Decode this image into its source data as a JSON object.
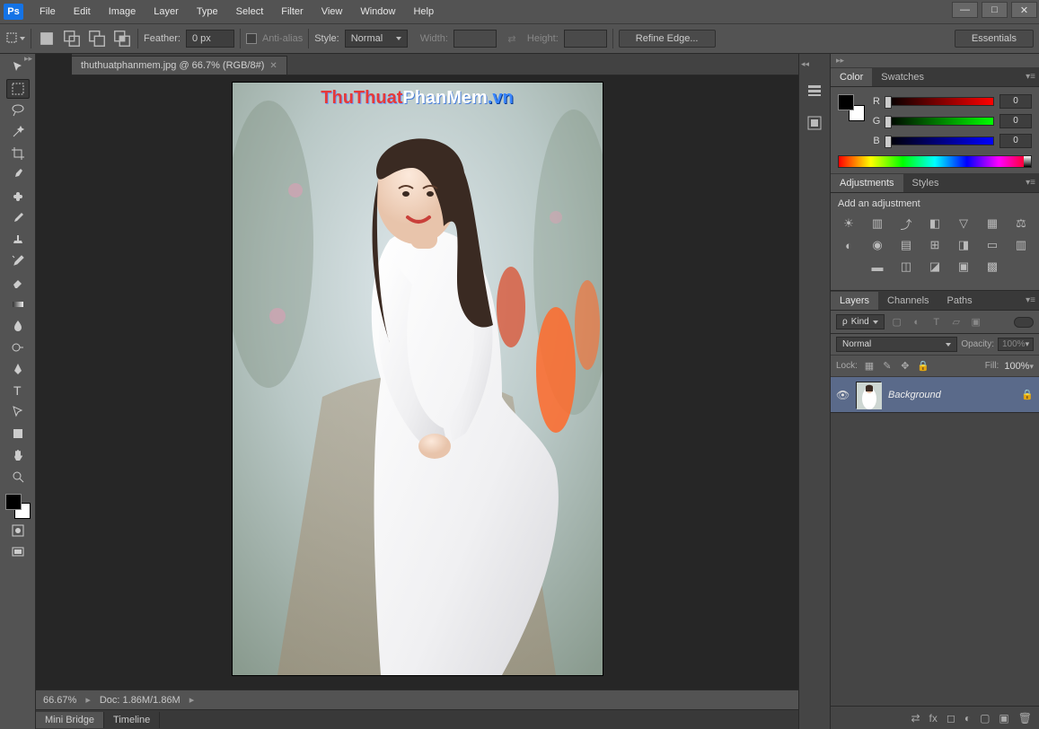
{
  "app": {
    "logo": "Ps"
  },
  "menu": [
    "File",
    "Edit",
    "Image",
    "Layer",
    "Type",
    "Select",
    "Filter",
    "View",
    "Window",
    "Help"
  ],
  "window_controls": {
    "min": "—",
    "max": "□",
    "close": "✕"
  },
  "options": {
    "feather_label": "Feather:",
    "feather_value": "0 px",
    "antialias": "Anti-alias",
    "style_label": "Style:",
    "style_value": "Normal",
    "width_label": "Width:",
    "height_label": "Height:",
    "refine": "Refine Edge...",
    "workspace": "Essentials"
  },
  "document": {
    "tab_title": "thuthuatphanmem.jpg @ 66.7% (RGB/8#)",
    "watermark": {
      "part1": "ThuThuat",
      "part2": "PhanMem",
      "part3": ".vn"
    }
  },
  "status": {
    "zoom": "66.67%",
    "doc": "Doc: 1.86M/1.86M"
  },
  "bottom_tabs": [
    "Mini Bridge",
    "Timeline"
  ],
  "panels": {
    "color": {
      "tabs": [
        "Color",
        "Swatches"
      ],
      "channels": [
        {
          "label": "R",
          "value": "0"
        },
        {
          "label": "G",
          "value": "0"
        },
        {
          "label": "B",
          "value": "0"
        }
      ]
    },
    "adjustments": {
      "tabs": [
        "Adjustments",
        "Styles"
      ],
      "hint": "Add an adjustment"
    },
    "layers": {
      "tabs": [
        "Layers",
        "Channels",
        "Paths"
      ],
      "filter_kind": "Kind",
      "blend_mode": "Normal",
      "opacity_label": "Opacity:",
      "opacity_value": "100%",
      "lock_label": "Lock:",
      "fill_label": "Fill:",
      "fill_value": "100%",
      "layer": {
        "name": "Background"
      }
    }
  }
}
